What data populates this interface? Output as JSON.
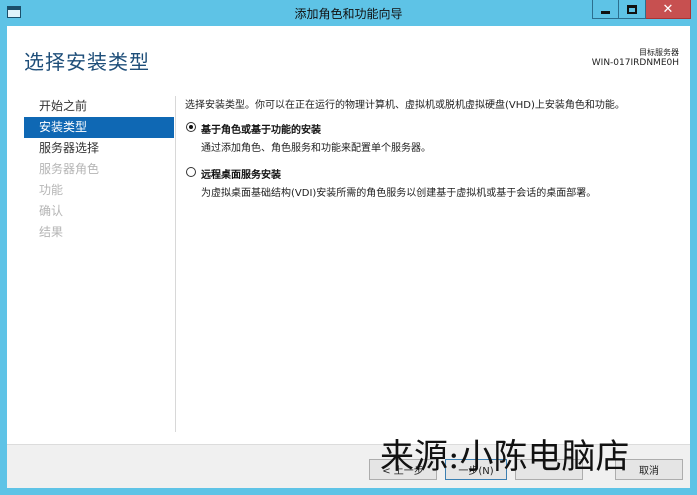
{
  "window": {
    "title": "添加角色和功能向导",
    "controls": {
      "minimize_icon": "minimize-icon",
      "maximize_icon": "maximize-icon",
      "close_icon": "close-icon"
    }
  },
  "header": {
    "page_title": "选择安装类型",
    "destination_label": "目标服务器",
    "destination_server": "WIN-017IRDNME0H"
  },
  "sidebar": {
    "items": [
      {
        "label": "开始之前",
        "state": "normal"
      },
      {
        "label": "安装类型",
        "state": "active"
      },
      {
        "label": "服务器选择",
        "state": "normal"
      },
      {
        "label": "服务器角色",
        "state": "disabled"
      },
      {
        "label": "功能",
        "state": "disabled"
      },
      {
        "label": "确认",
        "state": "disabled"
      },
      {
        "label": "结果",
        "state": "disabled"
      }
    ]
  },
  "main": {
    "intro": "选择安装类型。你可以在正在运行的物理计算机、虚拟机或脱机虚拟硬盘(VHD)上安装角色和功能。",
    "options": [
      {
        "title": "基于角色或基于功能的安装",
        "description": "通过添加角色、角色服务和功能来配置单个服务器。",
        "selected": true
      },
      {
        "title": "远程桌面服务安装",
        "description": "为虚拟桌面基础结构(VDI)安装所需的角色服务以创建基于虚拟机或基于会话的桌面部署。",
        "selected": false
      }
    ]
  },
  "footer": {
    "prev_label": "< 上一步",
    "next_label": "一步(N)",
    "install_label": "",
    "cancel_label": "取消"
  },
  "watermark": "来源:小陈电脑店",
  "colors": {
    "frame": "#5ec3e6",
    "accent": "#0f68b4",
    "title_text": "#1e4e79",
    "close_button": "#c75050"
  }
}
